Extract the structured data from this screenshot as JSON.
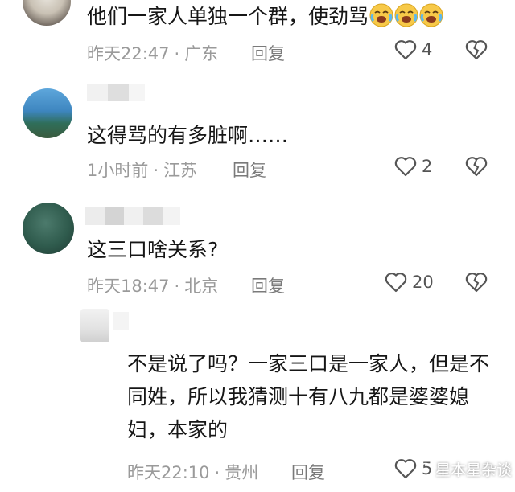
{
  "comments": [
    {
      "text": "他们一家人单独一个群，使劲骂",
      "emoji": [
        "cry-laugh-emoji",
        "cry-laugh-emoji",
        "cry-laugh-emoji"
      ],
      "time": "昨天22:47",
      "location": "广东",
      "reply_label": "回复",
      "likes": "4"
    },
    {
      "text": "这得骂的有多脏啊……",
      "time": "1小时前",
      "location": "江苏",
      "reply_label": "回复",
      "likes": "2"
    },
    {
      "text": "这三口啥关系?",
      "time": "昨天18:47",
      "location": "北京",
      "reply_label": "回复",
      "likes": "20"
    },
    {
      "text": "不是说了吗？一家三口是一家人，但是不同姓，所以我猜测十有八九都是婆婆媳妇，本家的",
      "time": "昨天22:10",
      "location": "贵州",
      "reply_label": "回复",
      "likes": "5"
    }
  ],
  "meta_separator": "·",
  "watermark": "星本星杂谈",
  "colors": {
    "text": "#161616",
    "meta": "#9a9a9a",
    "icon": "#555555",
    "avatar_blue": "#3e86c0",
    "avatar_teal": "#2f5b4d"
  },
  "icons": [
    "heart-outline-icon",
    "broken-heart-icon"
  ]
}
